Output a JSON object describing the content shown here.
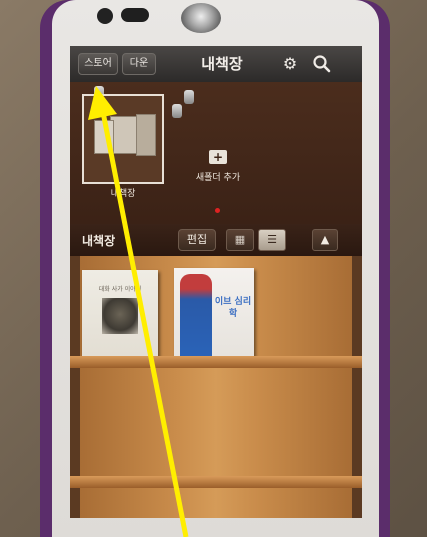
{
  "app": {
    "title": "내책장"
  },
  "toolbar": {
    "store_label": "스토어",
    "download_label": "다운",
    "settings_icon": "gear-icon",
    "search_icon": "search-icon"
  },
  "folders": {
    "items": [
      {
        "label": "내책장"
      }
    ],
    "new_folder_label": "새폴더 추가"
  },
  "shelf_bar": {
    "title": "내책장",
    "edit_label": "편집",
    "view_grid_icon": "grid-icon",
    "view_list_icon": "list-icon",
    "collapse_icon": "triangle-up-icon"
  },
  "books": [
    {
      "title": "대화 사가 이야기"
    },
    {
      "title": "이브 심리학"
    }
  ],
  "colors": {
    "annotation_arrow": "#ffee00",
    "page_indicator": "#dd2222"
  }
}
